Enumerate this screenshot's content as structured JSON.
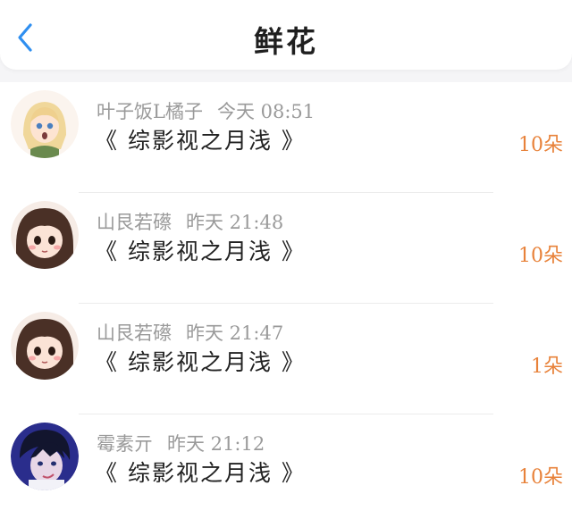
{
  "header": {
    "title": "鲜花",
    "back_icon": "chevron-left-icon",
    "back_color": "#2f8ff0"
  },
  "records": [
    {
      "user": "叶子饭L橘子",
      "time": "今天 08:51",
      "work": "《 综影视之月浅 》",
      "count": "10朵",
      "avatar": "blonde-girl-avatar"
    },
    {
      "user": "山艮若礤",
      "time": "昨天 21:48",
      "work": "《 综影视之月浅 》",
      "count": "10朵",
      "avatar": "brown-hair-girl-avatar"
    },
    {
      "user": "山艮若礤",
      "time": "昨天 21:47",
      "work": "《 综影视之月浅 》",
      "count": "1朵",
      "avatar": "brown-hair-girl-avatar"
    },
    {
      "user": "霉素亓",
      "time": "昨天 21:12",
      "work": "《 综影视之月浅 》",
      "count": "10朵",
      "avatar": "blue-boy-avatar"
    }
  ],
  "colors": {
    "accent": "#e8823a",
    "meta_text": "#9a9a9a",
    "body_text": "#222222"
  }
}
